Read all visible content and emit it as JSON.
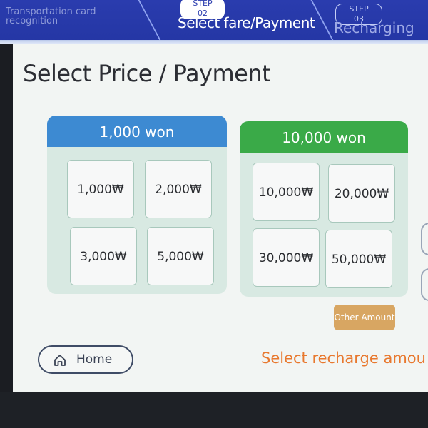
{
  "header": {
    "step1_label": "Transportation card recognition",
    "step2_badge": "STEP 02",
    "step2_label": "Select fare/Payment",
    "step3_badge": "STEP 03",
    "step3_label": "Recharging"
  },
  "main": {
    "title": "Select Price / Payment",
    "group_1000": {
      "title": "1,000 won",
      "options": [
        "1,000₩",
        "2,000₩",
        "3,000₩",
        "5,000₩"
      ]
    },
    "group_10000": {
      "title": "10,000 won",
      "options": [
        "10,000₩",
        "20,000₩",
        "30,000₩",
        "50,000₩"
      ]
    },
    "other_amount_label": "Other Amount",
    "home_label": "Home",
    "prompt": "Select recharge amou"
  },
  "icons": {
    "home": "home-icon"
  },
  "colors": {
    "header_bg": "#2a3cae",
    "group_1000_head": "#3d8ad2",
    "group_10000_head": "#3aaa48",
    "other_amount_bg": "#d8a662",
    "prompt_text": "#e8782e"
  }
}
